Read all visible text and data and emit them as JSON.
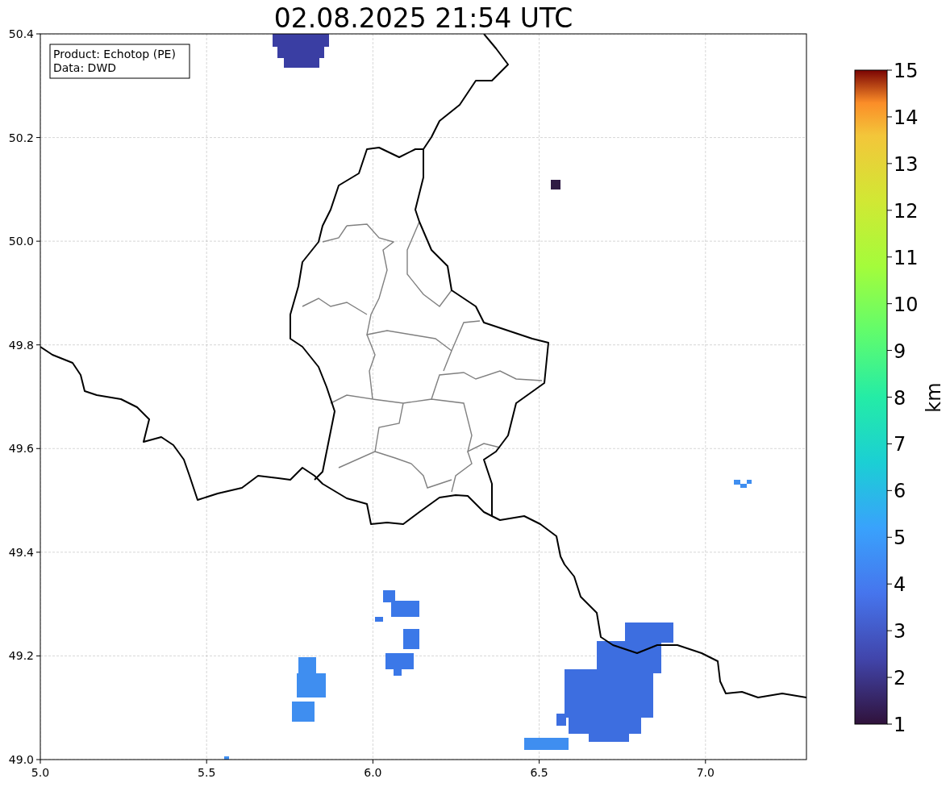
{
  "title": "02.08.2025 21:54 UTC",
  "map": {
    "legend": [
      "Product: Echotop (PE)",
      "Data: DWD"
    ],
    "xticks": [
      "5.0",
      "5.5",
      "6.0",
      "6.5",
      "7.0"
    ],
    "yticks": [
      "50.4",
      "50.2",
      "50.0",
      "49.8",
      "49.6",
      "49.4",
      "49.2",
      "49.0"
    ]
  },
  "colorbar": {
    "label": "km",
    "ticks": [
      "15",
      "14",
      "13",
      "12",
      "11",
      "10",
      "9",
      "8",
      "7",
      "6",
      "5",
      "4",
      "3",
      "2",
      "1"
    ]
  }
}
